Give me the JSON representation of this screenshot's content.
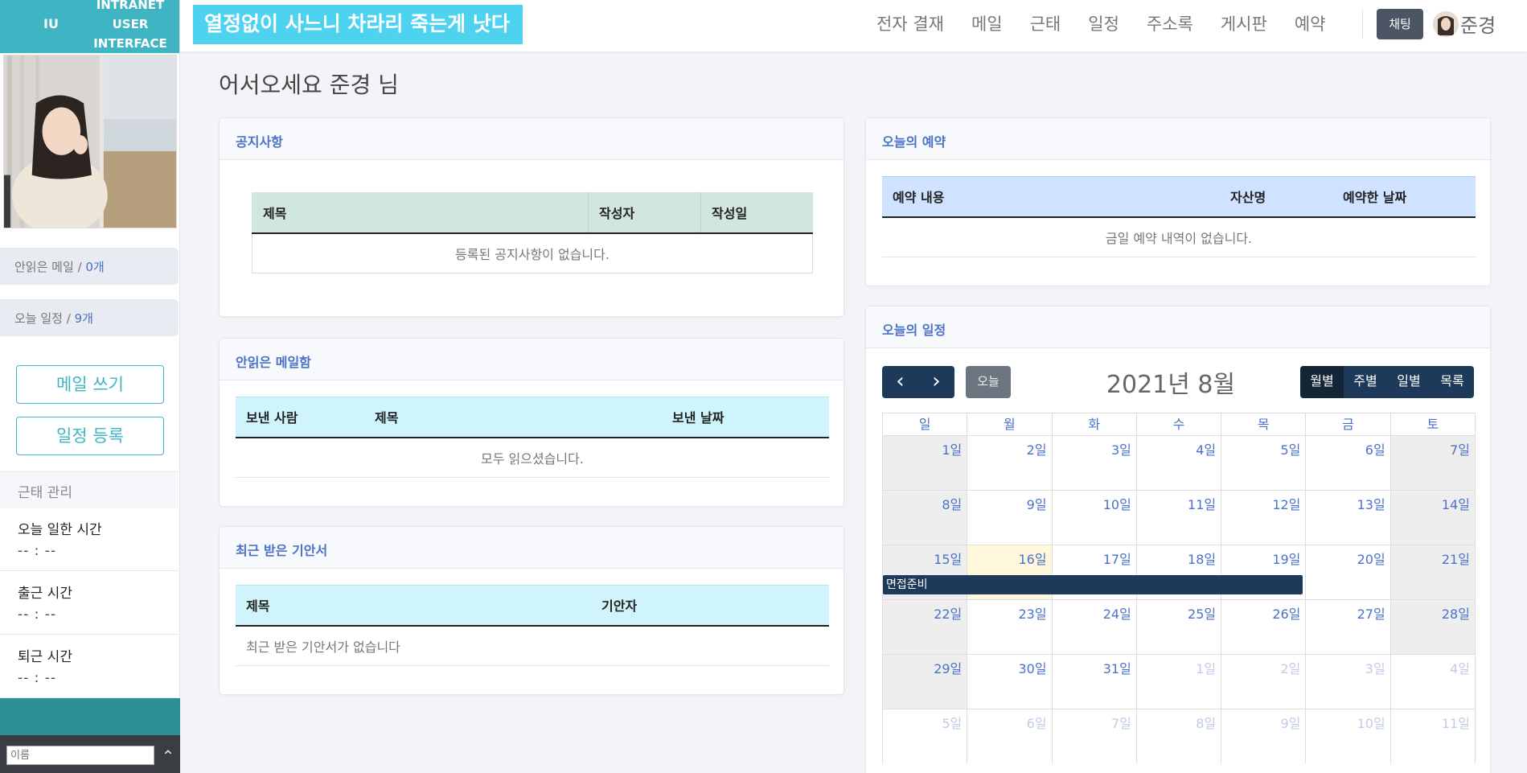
{
  "sidebar": {
    "logo_short": "IU",
    "logo_lines": [
      "INTRANET",
      "USER",
      "INTERFACE"
    ],
    "unread_mail": {
      "label": "안읽은 메일",
      "sep": "/",
      "count": "0개"
    },
    "today_schedule": {
      "label": "오늘 일정",
      "sep": "/",
      "count": "9개"
    },
    "write_mail_label": "메일 쓰기",
    "add_schedule_label": "일정 등록",
    "attendance": {
      "title": "근태 관리",
      "items": [
        {
          "label": "오늘 일한 시간",
          "value": "-- : --"
        },
        {
          "label": "출근 시간",
          "value": "-- : --"
        },
        {
          "label": "퇴근 시간",
          "value": "-- : --"
        }
      ]
    },
    "name_placeholder": "이름",
    "scroll_top_icon": "chevron-up-icon"
  },
  "header": {
    "banner": "열정없이 사느니 차라리 죽는게 낫다",
    "nav": [
      "전자 결재",
      "메일",
      "근태",
      "일정",
      "주소록",
      "게시판",
      "예약"
    ],
    "chat_label": "채팅",
    "user_name": "준경"
  },
  "main": {
    "welcome": "어서오세요 준경 님",
    "notice": {
      "title": "공지사항",
      "columns": [
        "제목",
        "작성자",
        "작성일"
      ],
      "empty": "등록된 공지사항이 없습니다."
    },
    "unread": {
      "title": "안읽은 메일함",
      "columns": [
        "보낸 사람",
        "제목",
        "보낸 날짜"
      ],
      "empty": "모두 읽으셨습니다."
    },
    "drafts": {
      "title": "최근 받은 기안서",
      "columns": [
        "제목",
        "기안자"
      ],
      "empty": "최근 받은 기안서가 없습니다"
    },
    "reservation": {
      "title": "오늘의 예약",
      "columns": [
        "예약 내용",
        "자산명",
        "예약한 날짜"
      ],
      "empty": "금일 예약 내역이 없습니다."
    },
    "calendar": {
      "title": "오늘의 일정",
      "month_label": "2021년 8월",
      "today_label": "오늘",
      "prev_icon": "chevron-left-icon",
      "next_icon": "chevron-right-icon",
      "views": [
        "월별",
        "주별",
        "일별",
        "목록"
      ],
      "active_view": "월별",
      "weekdays": [
        "일",
        "월",
        "화",
        "수",
        "목",
        "금",
        "토"
      ],
      "weeks": [
        [
          "1일",
          "2일",
          "3일",
          "4일",
          "5일",
          "6일",
          "7일"
        ],
        [
          "8일",
          "9일",
          "10일",
          "11일",
          "12일",
          "13일",
          "14일"
        ],
        [
          "15일",
          "16일",
          "17일",
          "18일",
          "19일",
          "20일",
          "21일"
        ],
        [
          "22일",
          "23일",
          "24일",
          "25일",
          "26일",
          "27일",
          "28일"
        ],
        [
          "29일",
          "30일",
          "31일",
          "1일",
          "2일",
          "3일",
          "4일"
        ],
        [
          "5일",
          "6일",
          "7일",
          "8일",
          "9일",
          "10일",
          "11일"
        ]
      ],
      "today": "16일",
      "event": {
        "title": "면접준비",
        "start": "15일",
        "end": "19일"
      }
    }
  }
}
